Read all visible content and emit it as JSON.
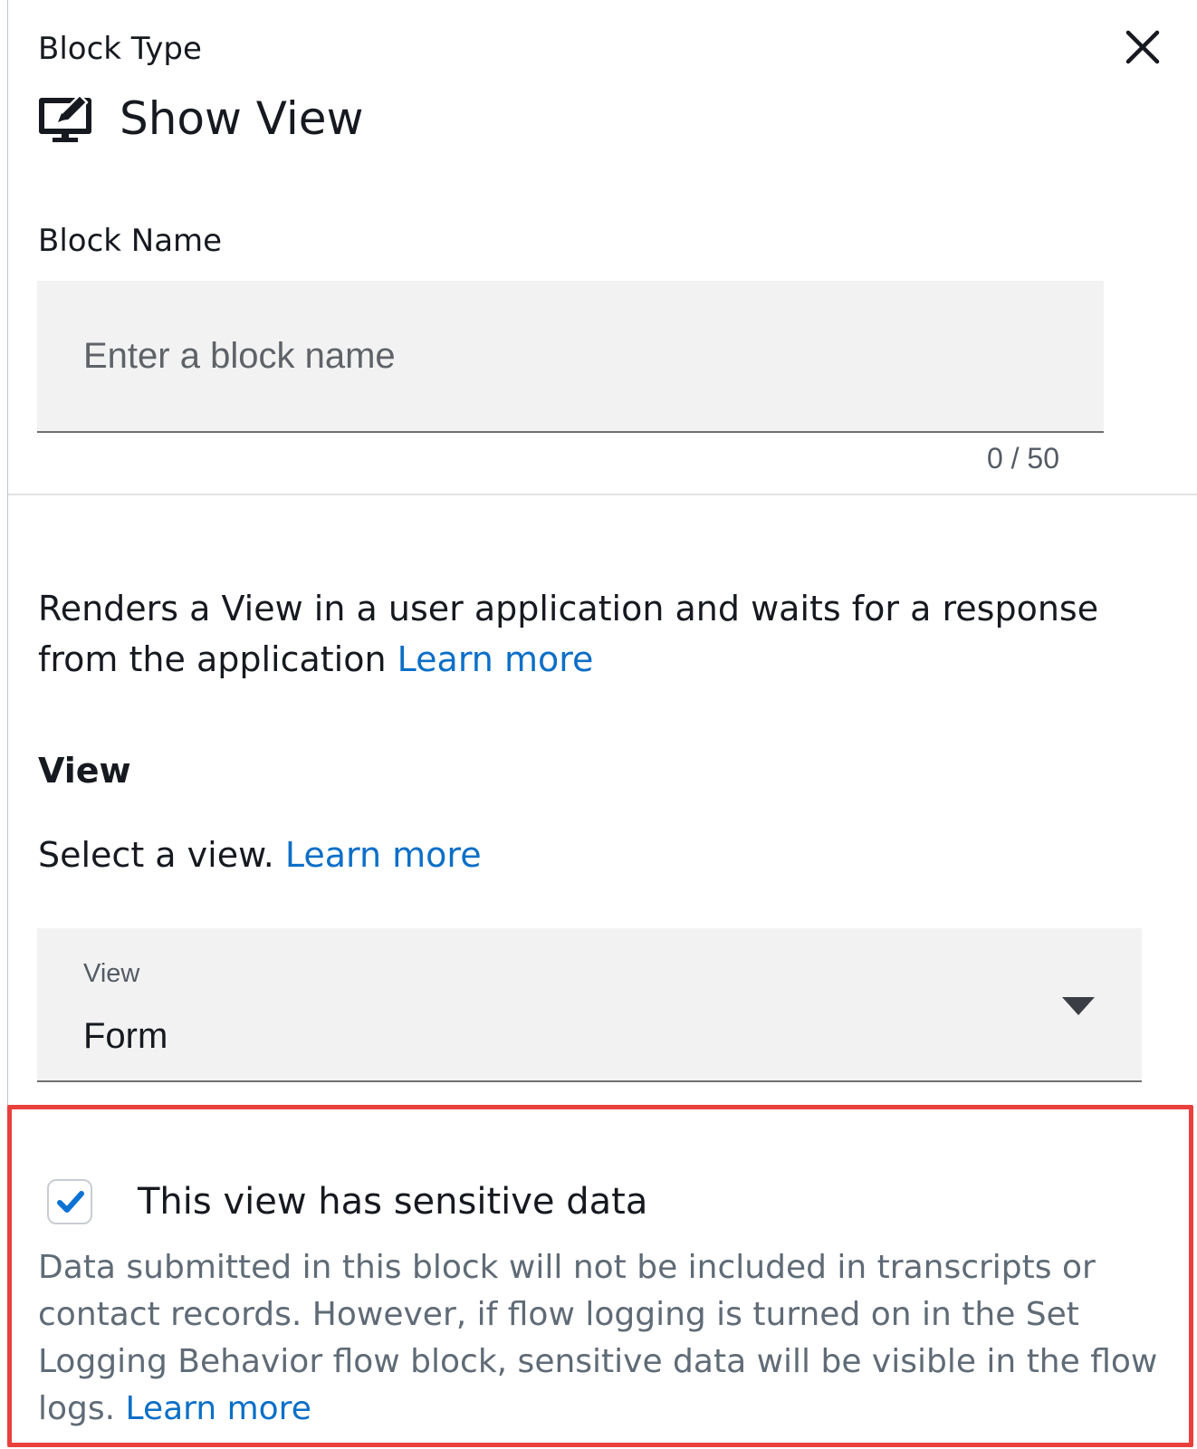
{
  "header": {
    "block_type_label": "Block Type",
    "title": "Show View",
    "title_icon": "monitor-edit-icon",
    "close_icon": "close-icon"
  },
  "block_name": {
    "label": "Block Name",
    "value": "",
    "placeholder": "Enter a block name",
    "char_count": "0 / 50"
  },
  "description": {
    "text": "Renders a View in a user application and waits for a response from the application",
    "link": "Learn more"
  },
  "view": {
    "heading": "View",
    "select_text": "Select a view.",
    "select_link": "Learn more",
    "dropdown": {
      "label": "View",
      "value": "Form",
      "caret_icon": "caret-down-icon"
    }
  },
  "sensitive": {
    "checked": true,
    "label": "This view has sensitive data",
    "description": "Data submitted in this block will not be included in transcripts or contact records. However, if flow logging is turned on in the Set Logging Behavior flow block, sensitive data will be visible in the flow logs.",
    "link": "Learn more",
    "highlight_color": "#e9403e",
    "check_color": "#0972d3"
  },
  "colors": {
    "link": "#0b6fc7",
    "text": "#16191f",
    "muted_text": "#5f6b76",
    "input_bg": "#f2f2f2"
  }
}
